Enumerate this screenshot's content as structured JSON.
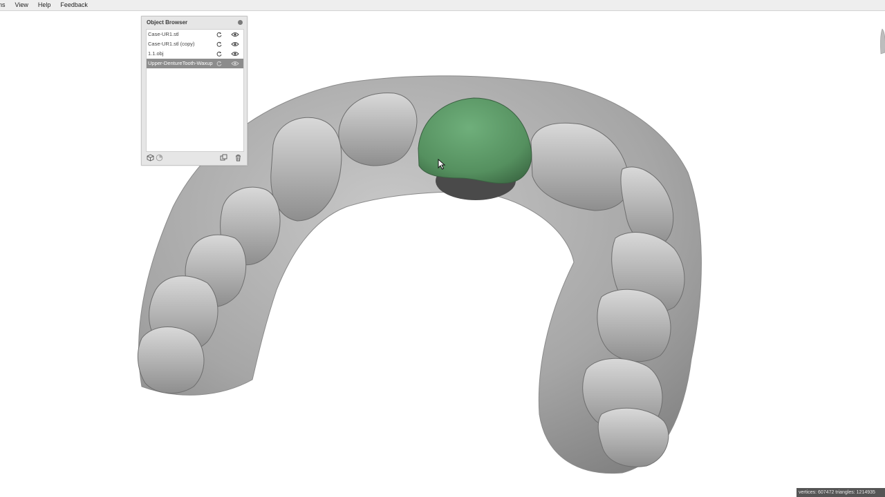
{
  "menu": {
    "items": [
      "ns",
      "View",
      "Help",
      "Feedback"
    ]
  },
  "object_browser": {
    "title": "Object Browser",
    "items": [
      {
        "name": "Case-UR1.stl",
        "selected": false
      },
      {
        "name": "Case-UR1.stl (copy)",
        "selected": false
      },
      {
        "name": "1.1.obj",
        "selected": false
      },
      {
        "name": "Upper-DentureTooth-Waxup",
        "selected": true
      }
    ],
    "footer_icons": [
      "cube-icon",
      "pie-icon",
      "duplicate-icon",
      "trash-icon"
    ]
  },
  "status": {
    "text": "vertices: 607472 triangles: 1214935"
  },
  "colors": {
    "model_gray": "#a9a9a9",
    "tooth_green": "#5f9a6a",
    "selected_row": "#8c8c8c"
  }
}
